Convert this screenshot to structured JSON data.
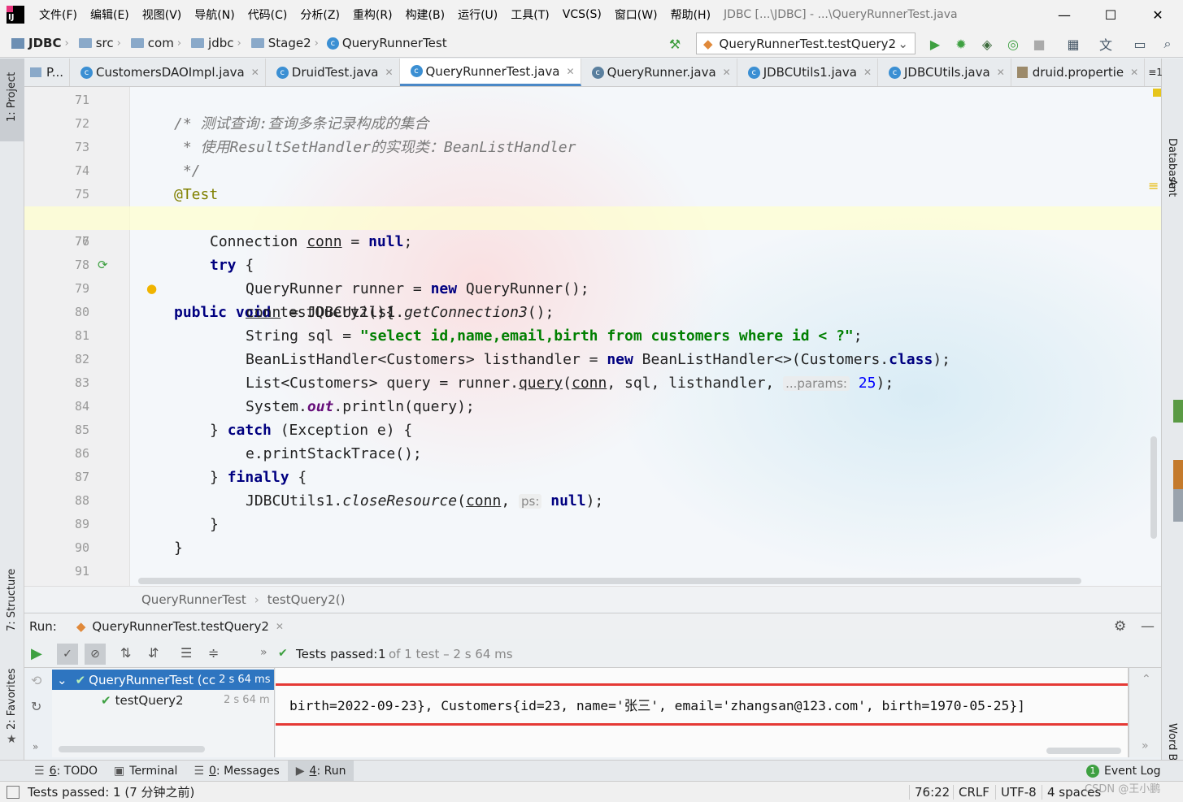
{
  "menu": {
    "items": [
      "文件(F)",
      "编辑(E)",
      "视图(V)",
      "导航(N)",
      "代码(C)",
      "分析(Z)",
      "重构(R)",
      "构建(B)",
      "运行(U)",
      "工具(T)",
      "VCS(S)",
      "窗口(W)",
      "帮助(H)"
    ],
    "window_title": "JDBC [...\\JDBC] - ...\\QueryRunnerTest.java"
  },
  "nav": {
    "project": "JDBC",
    "crumbs": [
      "src",
      "com",
      "jdbc",
      "Stage2"
    ],
    "class": "QueryRunnerTest",
    "run_config": "QueryRunnerTest.testQuery2"
  },
  "tabs": [
    {
      "label": "P..."
    },
    {
      "label": "CustomersDAOImpl.java"
    },
    {
      "label": "DruidTest.java"
    },
    {
      "label": "QueryRunnerTest.java"
    },
    {
      "label": "QueryRunner.java"
    },
    {
      "label": "JDBCUtils1.java"
    },
    {
      "label": "JDBCUtils.java"
    },
    {
      "label": "druid.propertie"
    }
  ],
  "tab_overflow": "≡1",
  "side": {
    "project": "1: Project",
    "structure": "7: Structure",
    "favorites": "2: Favorites",
    "database": "Database",
    "ant": "Ant",
    "wordbook": "Word Book"
  },
  "editor": {
    "line_numbers": [
      "71",
      "72",
      "73",
      "74",
      "75",
      "76",
      "77",
      "78",
      "79",
      "80",
      "81",
      "82",
      "83",
      "84",
      "85",
      "86",
      "87",
      "88",
      "89",
      "90",
      "91"
    ],
    "comment": {
      "l72": "/* 测试查询:查询多条记录构成的集合",
      "l73": " * 使用ResultSetHandler的实现类：BeanListHandler",
      "l74": " */"
    },
    "tokens": {
      "annotation": "@Test",
      "public": "public",
      "void": "void",
      "method": "testQuery2(){",
      "connection_type": "Connection",
      "conn": "conn",
      "eq": " = ",
      "null": "null",
      "semi": ";",
      "try": "try",
      "brace_open": " {",
      "runner_decl": "QueryRunner runner = ",
      "new": "new",
      "runner_ctor": " QueryRunner();",
      "conn_rhs": " = JDBCUtils1.",
      "getconn": "getConnection3",
      "call_end": "();",
      "sql_decl": "String sql = ",
      "sql_str": "\"select id,name,email,birth from customers where id < ?\"",
      "blh_decl": "BeanListHandler<Customers> listhandler = ",
      "blh_ctor": " BeanListHandler<>(Customers.",
      "class_kw": "class",
      "close_paren_semi": ");",
      "list_decl": "List<Customers> query = runner.",
      "query_call": "query",
      "open_paren": "(",
      "sql_args": ", sql, listhandler, ",
      "params_hint": "...params:",
      "param_val": "25",
      "sysout_1": "System.",
      "out": "out",
      "sysout_2": ".println(query);",
      "catch_pre": "} ",
      "catch": "catch",
      "catch_post": " (Exception e) {",
      "print_trace": "e.printStackTrace();",
      "finally": "finally",
      "close_pre": "JDBCUtils1.",
      "close_res": "closeResource",
      "comma": ",",
      "ps_hint": "ps:",
      "brace_close": "}"
    }
  },
  "breadcrumb": [
    "QueryRunnerTest",
    "testQuery2()"
  ],
  "run": {
    "label": "Run:",
    "config_tab": "QueryRunnerTest.testQuery2",
    "status_prefix": "Tests passed:",
    "status_count": "1",
    "status_rest": "of 1 test – 2 s 64 ms",
    "tree": [
      {
        "label": "QueryRunnerTest (cc",
        "time": "2 s 64 ms"
      },
      {
        "label": "testQuery2",
        "time": "2 s 64 m"
      }
    ],
    "console_line": "birth=2022-09-23}, Customers{id=23, name='张三', email='zhangsan@123.com', birth=1970-05-25}]"
  },
  "bottom_tabs": [
    {
      "num": "6",
      "label": ": TODO"
    },
    {
      "num": "",
      "label": "Terminal"
    },
    {
      "num": "0",
      "label": ": Messages"
    },
    {
      "num": "4",
      "label": ": Run"
    }
  ],
  "event_log": "Event Log",
  "event_count": "1",
  "status": {
    "message": "Tests passed: 1 (7 分钟之前)",
    "position": "76:22",
    "line_sep": "CRLF",
    "encoding": "UTF-8",
    "indent": "4 spaces",
    "watermark": "CSDN @王小鹏"
  },
  "colors": {
    "highlight_box": "#e53935",
    "keyword": "#000080",
    "string": "#007f00",
    "pass_green": "#3ea041",
    "accent": "#4a88c7"
  }
}
